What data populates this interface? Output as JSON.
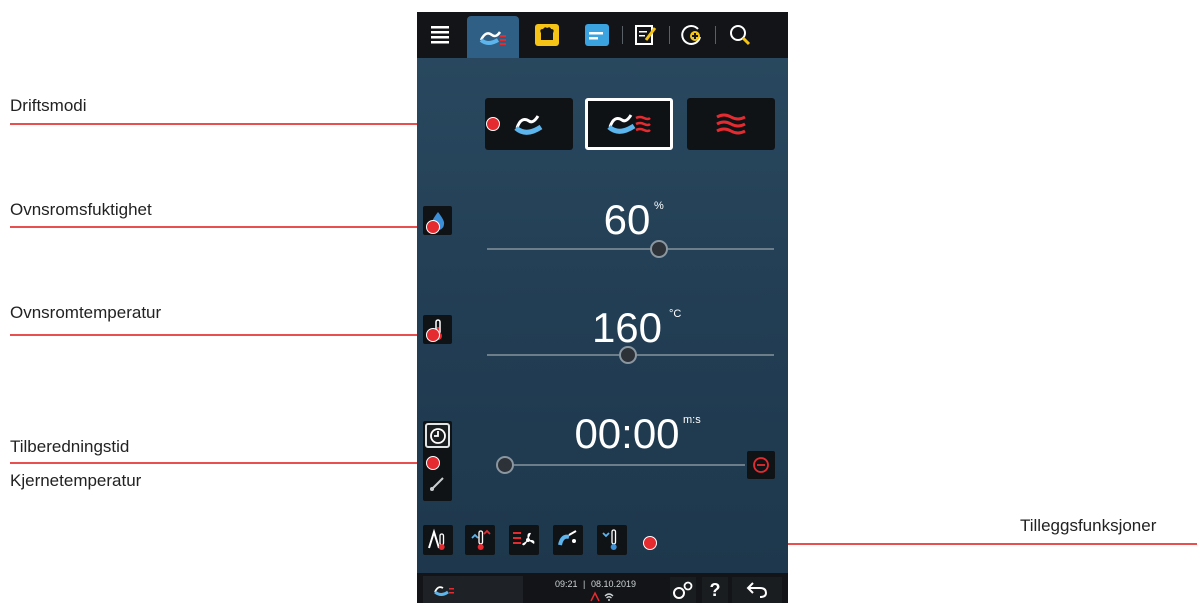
{
  "annotations": {
    "operating_modes": "Driftsmodi",
    "cabinet_humidity": "Ovnsromsfuktighet",
    "cabinet_temperature": "Ovnsromtemperatur",
    "cooking_time": "Tilberedningstid",
    "core_temperature": "Kjernetemperatur",
    "additional_functions": "Tilleggsfunksjoner"
  },
  "humidity": {
    "value": "60",
    "unit": "%",
    "level": 0.6
  },
  "temperature": {
    "value": "160",
    "unit": "°C",
    "level": 0.49
  },
  "time": {
    "value": "00:00",
    "unit": "m:s",
    "level": 0.0
  },
  "status": {
    "time": "09:21",
    "date": "08.10.2019"
  },
  "status_buttons": {
    "help": "?"
  },
  "colors": {
    "accent_red": "#e62b30",
    "steam_blue": "#3b8fd6",
    "panel_bg": "#243f55",
    "bar_bg": "#121417"
  }
}
